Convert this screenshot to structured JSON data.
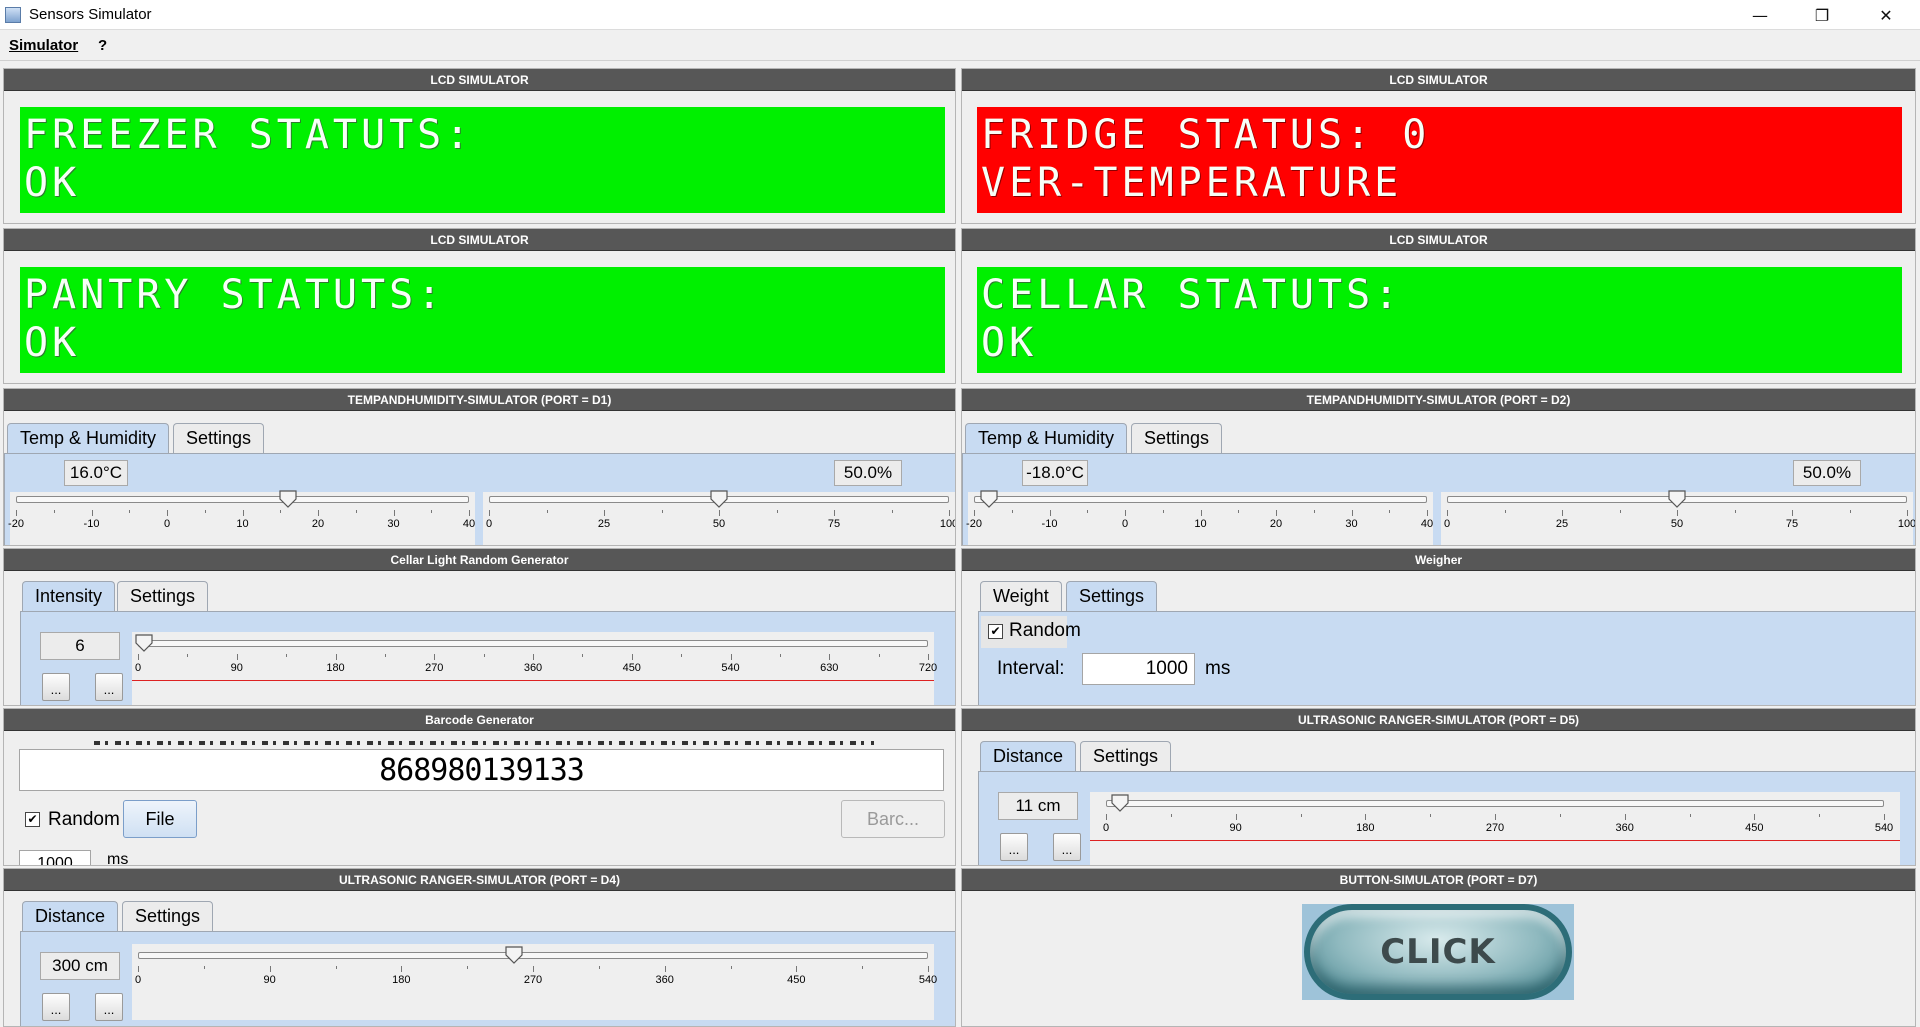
{
  "window": {
    "title": "Sensors Simulator",
    "minimize": "—",
    "maximize": "❐",
    "close": "✕"
  },
  "menu": {
    "simulator": "Simulator",
    "help": "?"
  },
  "lcd_panels": [
    {
      "header": "LCD SIMULATOR",
      "line1": "FREEZER STATUTS:",
      "line2": "OK",
      "color": "#00f000"
    },
    {
      "header": "LCD SIMULATOR",
      "line1": "FRIDGE STATUS: 0",
      "line2": "VER-TEMPERATURE",
      "color": "#ff0000"
    },
    {
      "header": "LCD SIMULATOR",
      "line1": "PANTRY STATUTS:",
      "line2": "OK",
      "color": "#00f000"
    },
    {
      "header": "LCD SIMULATOR",
      "line1": "CELLAR STATUTS:",
      "line2": "OK",
      "color": "#00f000"
    }
  ],
  "temp_panels": [
    {
      "header": "TEMPANDHUMIDITY-SIMULATOR (PORT = D1)",
      "tabs": [
        "Temp & Humidity",
        "Settings"
      ],
      "temp_value": "16.0°C",
      "humidity_value": "50.0%",
      "temp_ticks": [
        "-20",
        "-10",
        "0",
        "10",
        "20",
        "30",
        "40"
      ],
      "humidity_ticks": [
        "0",
        "25",
        "50",
        "75",
        "100"
      ],
      "temp": 16,
      "humidity": 50
    },
    {
      "header": "TEMPANDHUMIDITY-SIMULATOR (PORT = D2)",
      "tabs": [
        "Temp & Humidity",
        "Settings"
      ],
      "temp_value": "-18.0°C",
      "humidity_value": "50.0%",
      "temp_ticks": [
        "-20",
        "-10",
        "0",
        "10",
        "20",
        "30",
        "40"
      ],
      "humidity_ticks": [
        "0",
        "25",
        "50",
        "75",
        "100"
      ],
      "temp": -18,
      "humidity": 50
    }
  ],
  "cellar_light": {
    "header": "Cellar Light Random Generator",
    "tabs": [
      "Intensity",
      "Settings"
    ],
    "value": "6",
    "btn1": "...",
    "btn2": "...",
    "ticks": [
      "0",
      "90",
      "180",
      "270",
      "360",
      "450",
      "540",
      "630",
      "720"
    ],
    "level": 6
  },
  "weigher": {
    "header": "Weigher",
    "tabs": [
      "Weight",
      "Settings"
    ],
    "random_label": "Random",
    "random_checked": "✔",
    "interval_label": "Interval:",
    "interval_value": "1000",
    "unit": "ms"
  },
  "barcode": {
    "header": "Barcode Generator",
    "code": "868980139133",
    "random_label": "Random",
    "random_checked": "✔",
    "file_button": "File",
    "barcode_button": "Barc...",
    "interval_value": "1000",
    "unit": "ms"
  },
  "ultrasonic_d5": {
    "header": "ULTRASONIC RANGER-SIMULATOR (PORT = D5)",
    "tabs": [
      "Distance",
      "Settings"
    ],
    "value": "11 cm",
    "btn1": "...",
    "btn2": "...",
    "ticks": [
      "0",
      "90",
      "180",
      "270",
      "360",
      "450",
      "540"
    ],
    "distance": 11
  },
  "ultrasonic_d4": {
    "header": "ULTRASONIC RANGER-SIMULATOR (PORT = D4)",
    "tabs": [
      "Distance",
      "Settings"
    ],
    "value": "300 cm",
    "btn1": "...",
    "btn2": "...",
    "ticks": [
      "0",
      "90",
      "180",
      "270",
      "360",
      "450",
      "540"
    ],
    "distance": 300
  },
  "button_sim": {
    "header": "BUTTON-SIMULATOR (PORT = D7)",
    "label": "CLICK"
  }
}
